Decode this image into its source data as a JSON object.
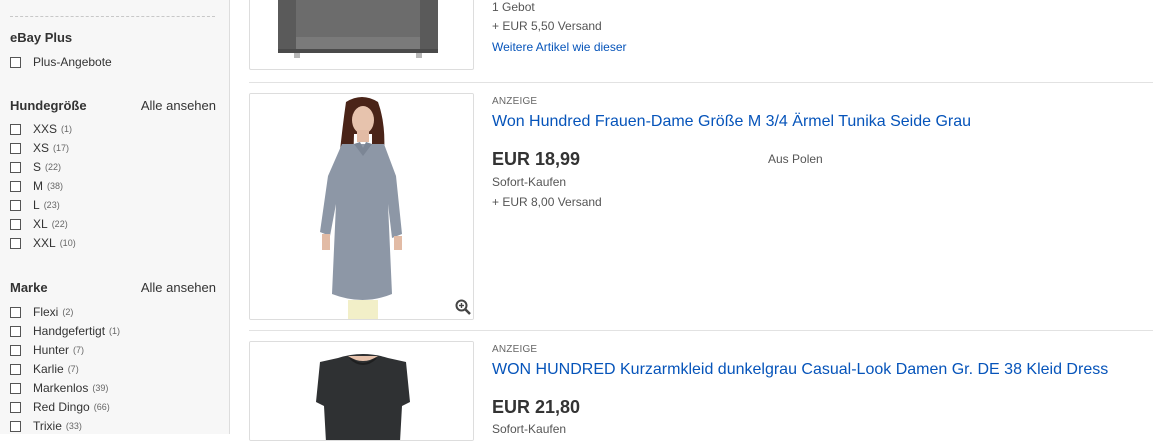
{
  "sidebar": {
    "ebay_plus": {
      "title": "eBay Plus",
      "options": [
        {
          "label": "Plus-Angebote"
        }
      ]
    },
    "size": {
      "title": "Hundegröße",
      "see_all": "Alle ansehen",
      "options": [
        {
          "label": "XXS",
          "count": "(1)"
        },
        {
          "label": "XS",
          "count": "(17)"
        },
        {
          "label": "S",
          "count": "(22)"
        },
        {
          "label": "M",
          "count": "(38)"
        },
        {
          "label": "L",
          "count": "(23)"
        },
        {
          "label": "XL",
          "count": "(22)"
        },
        {
          "label": "XXL",
          "count": "(10)"
        }
      ]
    },
    "brand": {
      "title": "Marke",
      "see_all": "Alle ansehen",
      "options": [
        {
          "label": "Flexi",
          "count": "(2)"
        },
        {
          "label": "Handgefertigt",
          "count": "(1)"
        },
        {
          "label": "Hunter",
          "count": "(7)"
        },
        {
          "label": "Karlie",
          "count": "(7)"
        },
        {
          "label": "Markenlos",
          "count": "(39)"
        },
        {
          "label": "Red Dingo",
          "count": "(66)"
        },
        {
          "label": "Trixie",
          "count": "(33)"
        }
      ]
    }
  },
  "listings": [
    {
      "bids": "1 Gebot",
      "shipping": "+ EUR 5,50 Versand",
      "more_link": "Weitere Artikel wie dieser"
    },
    {
      "ad_label": "ANZEIGE",
      "title": "Won Hundred Frauen-Dame Größe M 3/4 Ärmel Tunika Seide Grau",
      "price": "EUR 18,99",
      "format": "Sofort-Kaufen",
      "shipping": "+ EUR 8,00 Versand",
      "origin": "Aus Polen"
    },
    {
      "ad_label": "ANZEIGE",
      "title": "WON HUNDRED Kurzarmkleid dunkelgrau Casual-Look Damen Gr. DE 38 Kleid Dress",
      "price": "EUR 21,80",
      "format": "Sofort-Kaufen"
    }
  ],
  "colors": {
    "link": "#0654ba",
    "sidebar_bg": "#f7f7f7",
    "divider": "#e2e2e2"
  },
  "icons": {
    "zoom": "magnifier-plus-icon"
  }
}
